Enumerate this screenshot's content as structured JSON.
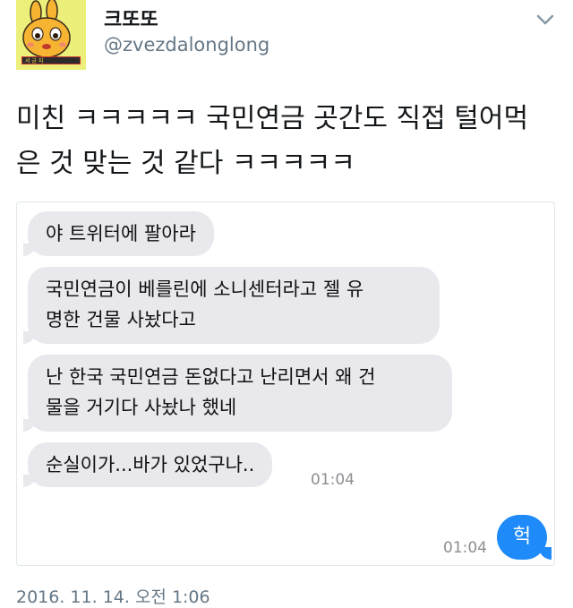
{
  "author": {
    "display_name": "크또또",
    "handle": "@zvezdalonglong",
    "avatar_badge": "서 금 지"
  },
  "tweet": {
    "line1": "미친 ㅋㅋㅋㅋㅋ 국민연금 곳간도 직접 털어먹",
    "line2": "은 것 맞는 것 같다 ㅋㅋㅋㅋㅋ",
    "timestamp": "2016. 11. 14. 오전 1:06"
  },
  "chat": {
    "messages": [
      {
        "text": "야 트위터에 팔아라"
      },
      {
        "line1": "국민연금이 베를린에 소니센터라고 젤 유",
        "line2": "명한 건물 사놨다고"
      },
      {
        "line1": "난 한국 국민연금 돈없다고 난리면서 왜 건",
        "line2": "물을 거기다 사놨나 했네"
      },
      {
        "text": "순실이가...바가 있었구나..",
        "time": "01:04"
      }
    ],
    "reply": {
      "text": "헉",
      "time": "01:04"
    }
  },
  "colors": {
    "accent_blue": "#1f8bfa",
    "bubble_gray": "#e8e8ed",
    "avatar_bg": "#ecf07a"
  },
  "icons": [
    "chevron-down-icon",
    "rabbit-avatar-icon"
  ]
}
